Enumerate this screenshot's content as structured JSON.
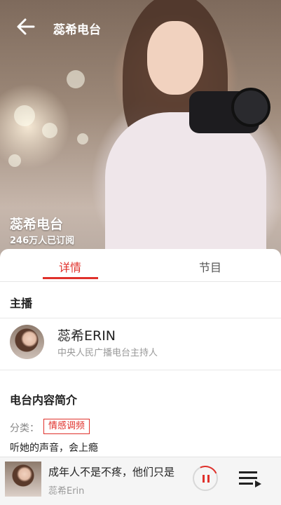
{
  "header": {
    "title": "蕊希电台"
  },
  "hero": {
    "name": "蕊希电台",
    "subscribers": "246万人已订阅"
  },
  "tabs": [
    {
      "label": "详情"
    },
    {
      "label": "节目"
    }
  ],
  "host_section": {
    "title": "主播",
    "name": "蕊希ERIN",
    "description": "中央人民广播电台主持人"
  },
  "intro_section": {
    "title": "电台内容简介",
    "category_label": "分类：",
    "category_tag": "情感调频",
    "text": "听她的声音，会上瘾"
  },
  "player": {
    "track": "成年人不是不疼，他们只是",
    "artist": "蕊希Erin",
    "state": "playing"
  },
  "colors": {
    "accent": "#e0312b"
  },
  "icons": [
    "back-arrow-icon",
    "pause-icon",
    "playlist-icon"
  ]
}
